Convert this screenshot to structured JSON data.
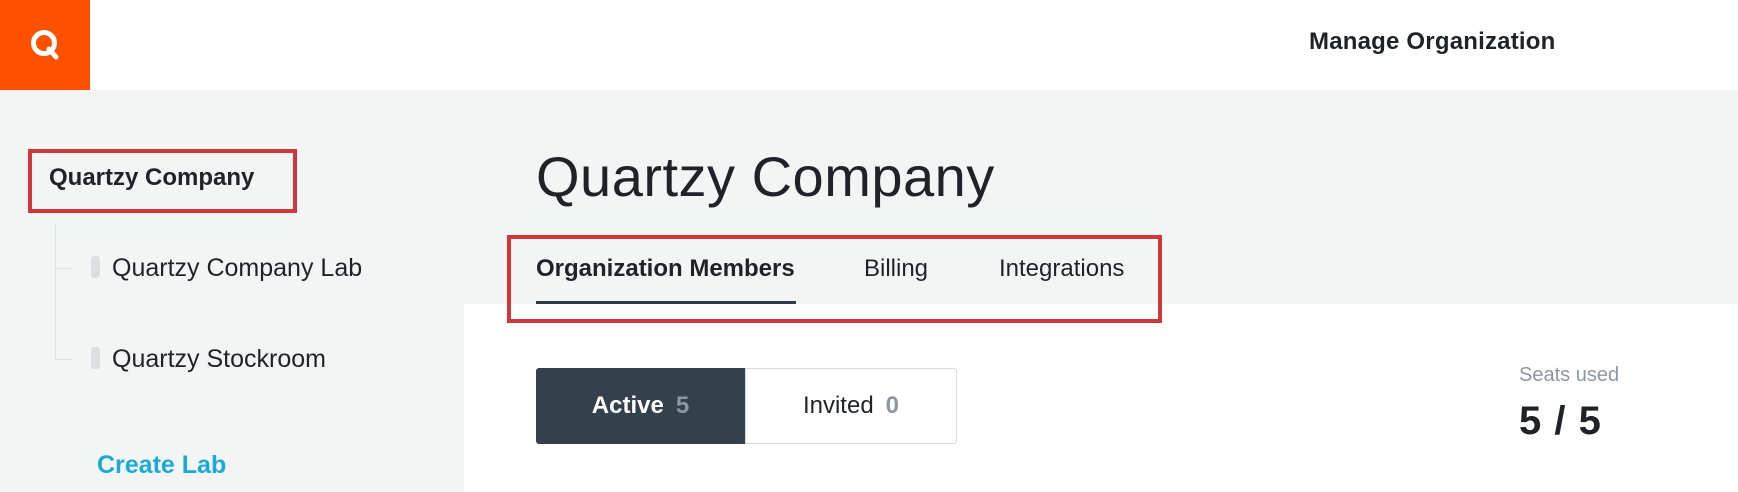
{
  "header": {
    "logo_alt": "Quartzy logo",
    "logo_color": "#ff5000",
    "manage_link": "Manage Organization"
  },
  "sidebar": {
    "org_name": "Quartzy Company",
    "labs": [
      {
        "label": "Quartzy Company Lab"
      },
      {
        "label": "Quartzy Stockroom"
      }
    ],
    "create_lab": "Create Lab"
  },
  "main": {
    "title": "Quartzy Company",
    "tabs": [
      {
        "label": "Organization Members",
        "active": true
      },
      {
        "label": "Billing",
        "active": false
      },
      {
        "label": "Integrations",
        "active": false
      }
    ],
    "members_filter": {
      "active_label": "Active",
      "active_count": "5",
      "invited_label": "Invited",
      "invited_count": "0"
    },
    "seats": {
      "label": "Seats used",
      "value": "5 / 5"
    }
  },
  "colors": {
    "accent_blue": "#1ba9d8",
    "highlight_red": "#d1363b",
    "dark_segment": "#34414d"
  }
}
